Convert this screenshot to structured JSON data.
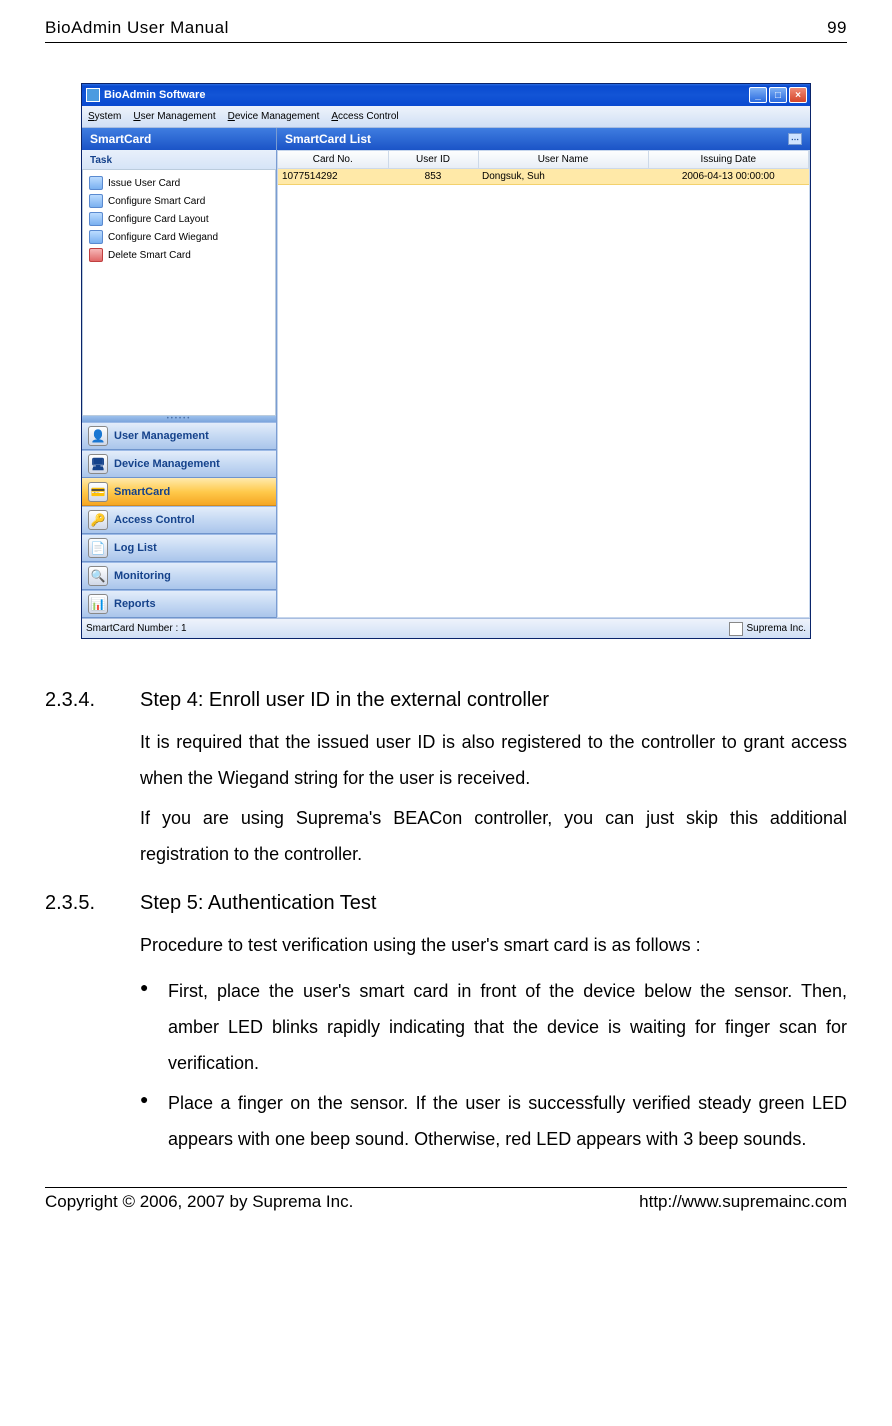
{
  "header": {
    "left": "BioAdmin  User  Manual",
    "right": "99"
  },
  "app": {
    "title": "BioAdmin Software",
    "menus": [
      {
        "u": "S",
        "rest": "ystem"
      },
      {
        "u": "U",
        "rest": "ser Management"
      },
      {
        "u": "D",
        "rest": "evice Management"
      },
      {
        "u": "A",
        "rest": "ccess Control"
      }
    ],
    "left_panel_title": "SmartCard",
    "task_header": "Task",
    "tasks": [
      {
        "label": "Issue User Card",
        "icon": "card"
      },
      {
        "label": "Configure Smart Card",
        "icon": "card"
      },
      {
        "label": "Configure Card Layout",
        "icon": "card"
      },
      {
        "label": "Configure Card Wiegand",
        "icon": "card"
      },
      {
        "label": "Delete Smart Card",
        "icon": "delete"
      }
    ],
    "nav": [
      {
        "label": "User Management",
        "glyph": "👤",
        "active": false
      },
      {
        "label": "Device Management",
        "glyph": "🖥",
        "active": false
      },
      {
        "label": "SmartCard",
        "glyph": "💳",
        "active": true
      },
      {
        "label": "Access Control",
        "glyph": "🔑",
        "active": false
      },
      {
        "label": "Log List",
        "glyph": "📄",
        "active": false
      },
      {
        "label": "Monitoring",
        "glyph": "🔍",
        "active": false
      },
      {
        "label": "Reports",
        "glyph": "📊",
        "active": false
      }
    ],
    "list_title": "SmartCard List",
    "columns": [
      "Card No.",
      "User ID",
      "User Name",
      "Issuing Date"
    ],
    "rows": [
      {
        "card_no": "1077514292",
        "user_id": "853",
        "user_name": "Dongsuk, Suh",
        "issuing_date": "2006-04-13 00:00:00"
      }
    ],
    "status_left": "SmartCard Number : 1",
    "status_right": "Suprema Inc."
  },
  "section1": {
    "num": "2.3.4.",
    "title": "Step 4: Enroll user ID in the external controller",
    "p1": "It is required that the issued user ID is also registered to the controller to grant access when the Wiegand string for the user is received.",
    "p2": "If you are using Suprema's BEACon controller, you can just skip this additional registration to the controller."
  },
  "section2": {
    "num": "2.3.5.",
    "title": "Step 5: Authentication Test",
    "p1": "Procedure to test verification using the user's smart card is as follows :",
    "bullets": [
      "First, place the user's smart card in front of the device below the sensor. Then, amber LED blinks rapidly indicating that the device is waiting for finger scan for verification.",
      "Place a finger on the sensor. If the user is successfully verified steady green LED appears with one beep sound. Otherwise, red LED appears with 3 beep sounds."
    ]
  },
  "footer": {
    "left": "Copyright © 2006, 2007 by Suprema Inc.",
    "right": "http://www.supremainc.com"
  }
}
